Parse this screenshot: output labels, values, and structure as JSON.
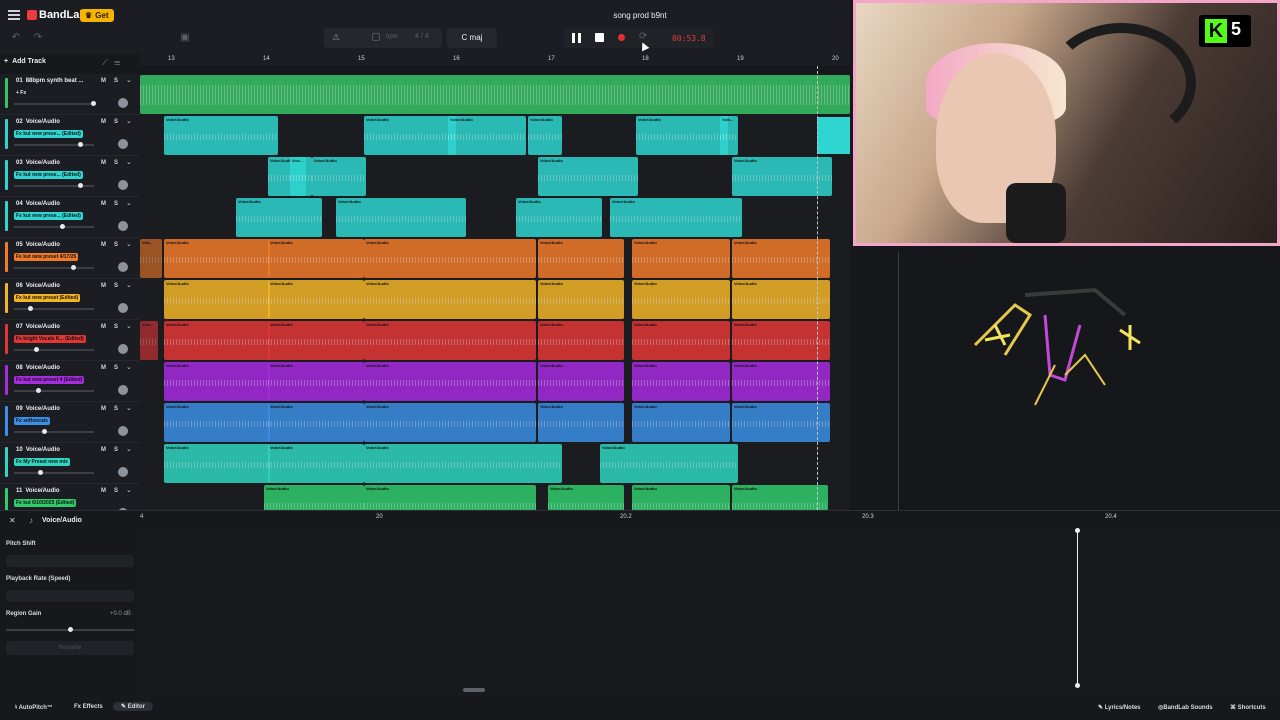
{
  "app": {
    "brand": "BandLab",
    "get_label": "Get",
    "song_title": "song prod b9nt"
  },
  "toolbar": {
    "bpm_label": "bpm",
    "time_sig": "4 / 4",
    "key": "C maj",
    "timecode": "00:53.8"
  },
  "tracklist": {
    "add_track": "Add Track",
    "tracks": [
      {
        "num": "01",
        "name": "88bpm synth beat ...",
        "fx": "+ Fx",
        "color": "#36c466"
      },
      {
        "num": "02",
        "name": "Voice/Audio",
        "fx": "Fx kut new prese... (Edited)",
        "color": "#2fd5d0"
      },
      {
        "num": "03",
        "name": "Voice/Audio",
        "fx": "Fx kut new prese... (Edited)",
        "color": "#2fd5d0"
      },
      {
        "num": "04",
        "name": "Voice/Audio",
        "fx": "Fx kut new prese... (Edited)",
        "color": "#2fd5d0"
      },
      {
        "num": "05",
        "name": "Voice/Audio",
        "fx": "Fx kut new preset 4/17/25",
        "color": "#f07a2a"
      },
      {
        "num": "06",
        "name": "Voice/Audio",
        "fx": "Fx kut new preset (Edited)",
        "color": "#f3b426"
      },
      {
        "num": "07",
        "name": "Voice/Audio",
        "fx": "Fx bright Vocals K... (Edited)",
        "color": "#e23636"
      },
      {
        "num": "08",
        "name": "Voice/Audio",
        "fx": "Fx kut new preset 4 (Edited)",
        "color": "#a72be0"
      },
      {
        "num": "09",
        "name": "Voice/Audio",
        "fx": "Fx softvocals",
        "color": "#3b8fe6"
      },
      {
        "num": "10",
        "name": "Voice/Audio",
        "fx": "Fx My Preset new mix",
        "color": "#2fd5c0"
      },
      {
        "num": "11",
        "name": "Voice/Audio",
        "fx": "Fx kut 6/10/2025 (Edited)",
        "color": "#2ecc6a"
      }
    ]
  },
  "ruler": {
    "bars": [
      "13",
      "14",
      "15",
      "16",
      "17",
      "18",
      "19",
      "20"
    ]
  },
  "clip_label": "Voice/Audio",
  "clip_label_short": "Voic...",
  "editor": {
    "title": "Voice/Audio",
    "ruler": [
      "4",
      "20",
      "20.2",
      "20.3",
      "20.4"
    ],
    "pitch_shift": "Pitch Shift",
    "playback_rate": "Playback Rate (Speed)",
    "region_gain": "Region Gain",
    "gain_value": "+0.0 dB",
    "rename": "Rename"
  },
  "bottombar": {
    "autopitch": "AutoPitch™",
    "effects": "Effects",
    "editor": "Editor",
    "lyrics": "Lyrics/Notes",
    "sounds": "BandLab Sounds",
    "shortcuts": "Shortcuts"
  },
  "webcam": {
    "badge_number": "5",
    "badge_letter": "K"
  }
}
